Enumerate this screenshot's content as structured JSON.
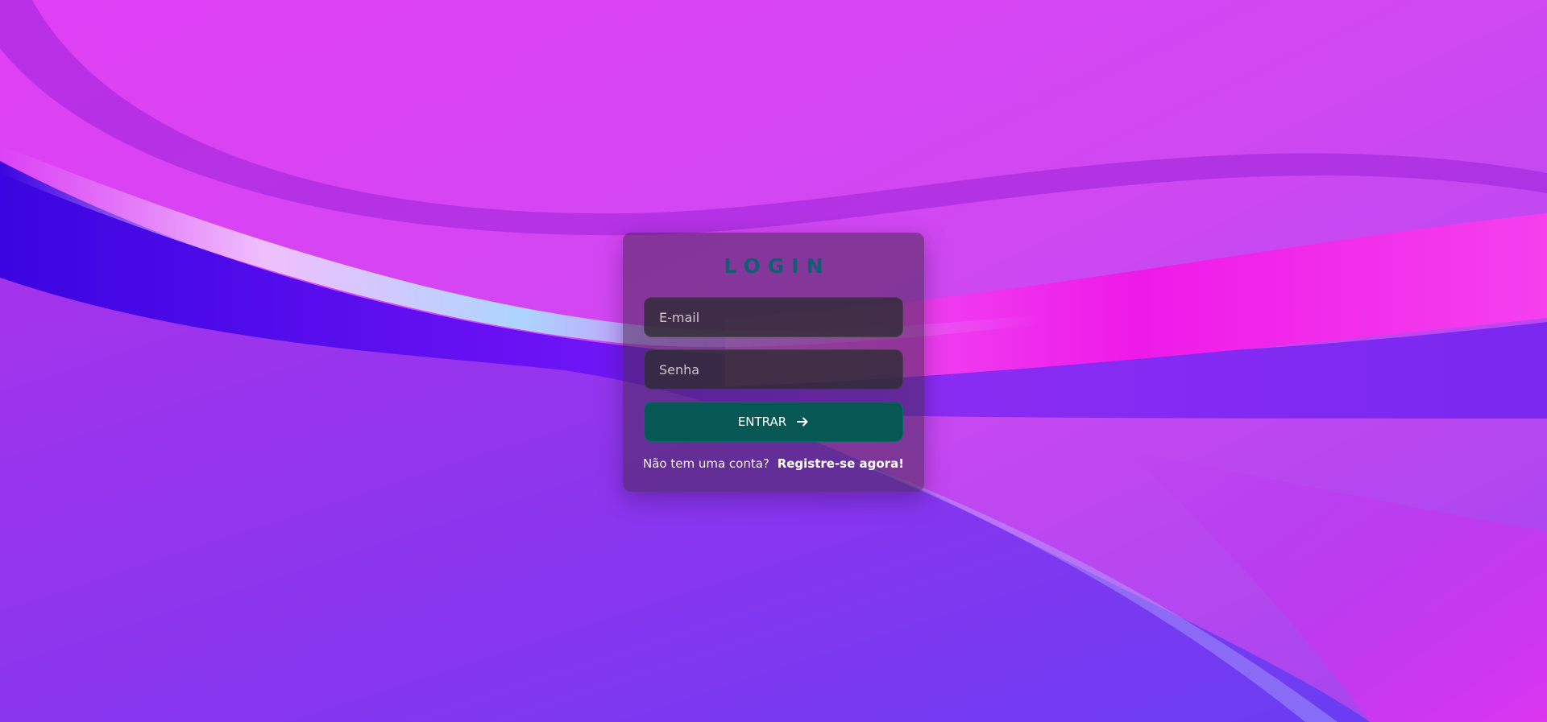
{
  "login": {
    "title": "LOGIN",
    "email_placeholder": "E-mail",
    "password_placeholder": "Senha",
    "submit_label": "ENTRAR",
    "submit_icon": "arrow-right-icon",
    "register_prompt": "Não tem uma conta?",
    "register_link": "Registre-se agora!"
  },
  "colors": {
    "title": "#0f5f73",
    "button_bg": "#075755",
    "card_bg": "rgba(70, 40, 80, 0.55)",
    "input_bg": "rgba(48, 44, 52, 0.82)"
  }
}
